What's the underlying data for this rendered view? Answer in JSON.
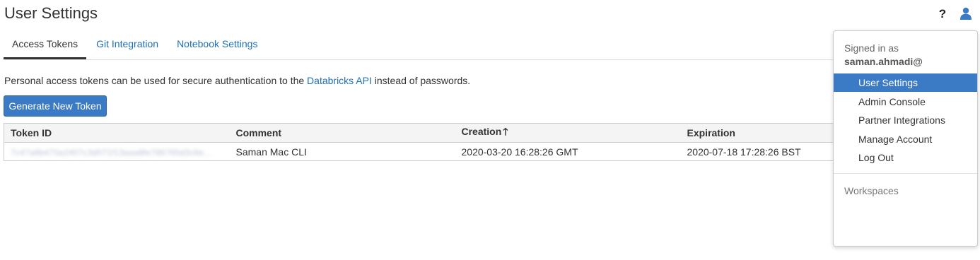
{
  "header": {
    "title": "User Settings",
    "help_glyph": "?"
  },
  "tabs": [
    {
      "label": "Access Tokens",
      "active": true
    },
    {
      "label": "Git Integration",
      "active": false
    },
    {
      "label": "Notebook Settings",
      "active": false
    }
  ],
  "intro": {
    "before": "Personal access tokens can be used for secure authentication to the ",
    "link": "Databricks API",
    "after": " instead of passwords."
  },
  "generate_button": "Generate New Token",
  "table": {
    "headers": {
      "token_id": "Token ID",
      "comment": "Comment",
      "creation": "Creation",
      "creation_sort_glyph": "🡑",
      "expiration": "Expiration"
    },
    "rows": [
      {
        "token_id": "7c47a8b470a2407c3d071f13aaa8fe786765d3c6e…",
        "comment": "Saman Mac CLI",
        "creation": "2020-03-20 16:28:26 GMT",
        "expiration": "2020-07-18 17:28:26 BST"
      }
    ]
  },
  "user_menu": {
    "signed_in_label": "Signed in as",
    "email": "saman.ahmadi@",
    "items": [
      {
        "label": "User Settings",
        "active": true
      },
      {
        "label": "Admin Console",
        "active": false
      },
      {
        "label": "Partner Integrations",
        "active": false
      },
      {
        "label": "Manage Account",
        "active": false
      },
      {
        "label": "Log Out",
        "active": false
      }
    ],
    "workspaces_label": "Workspaces"
  },
  "colors": {
    "accent": "#3b7ac5",
    "link": "#1f6fb5"
  }
}
